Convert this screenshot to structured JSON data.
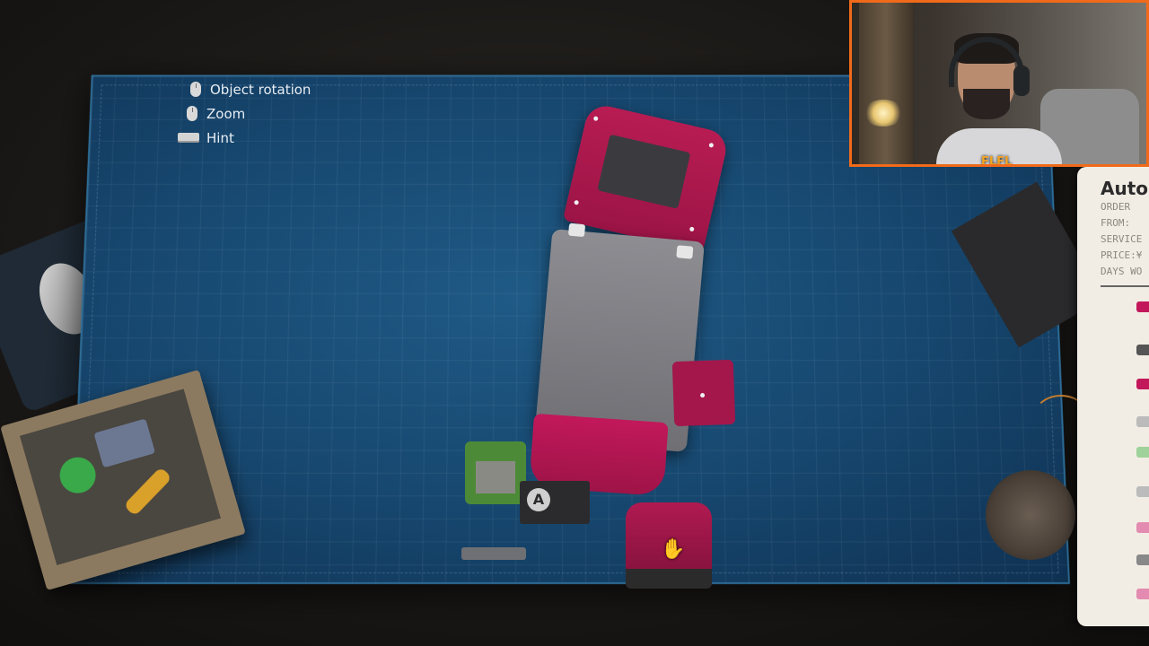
{
  "controls": {
    "items": [
      {
        "icon": "mouse-left-click-icon",
        "label": "Object rotation"
      },
      {
        "icon": "mouse-scroll-icon",
        "label": "Zoom"
      },
      {
        "icon": "spacebar-key-icon",
        "label": "Hint"
      }
    ]
  },
  "order_sheet": {
    "title": "Auto",
    "lines": [
      "ORDER",
      "FROM:",
      "SERVICE",
      "PRICE:¥",
      "DAYS WO"
    ]
  },
  "parts": {
    "battery_logo": "A"
  },
  "webcam": {
    "badge": "FLFL"
  },
  "colors": {
    "phone_body": "#b71c52",
    "mat": "#174870",
    "webcam_border": "#f06a1a",
    "pcb": "#4d8a38"
  }
}
